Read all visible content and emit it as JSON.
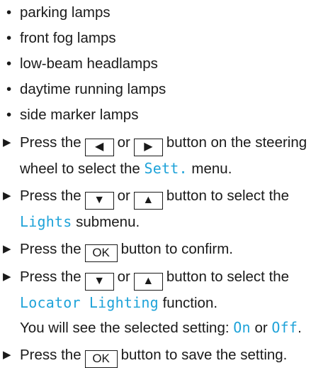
{
  "bullets": [
    "parking lamps",
    "front fog lamps",
    "low-beam headlamps",
    "daytime running lamps",
    "side marker lamps"
  ],
  "bullet_glyph": "•",
  "step_glyph": "▶",
  "keys": {
    "left": "◀",
    "right": "▶",
    "down": "▼",
    "up": "▲",
    "ok": "OK"
  },
  "steps": {
    "s1": {
      "t1": "Press the",
      "t2": "or",
      "t3": "button on the steering wheel to select the",
      "menu": "Sett.",
      "t4": "menu."
    },
    "s2": {
      "t1": "Press the",
      "t2": "or",
      "t3": "button to select the",
      "submenu": "Lights",
      "t4": "submenu."
    },
    "s3": {
      "t1": "Press the",
      "t2": "button to confirm."
    },
    "s4": {
      "t1": "Press the",
      "t2": "or",
      "t3": "button to select the",
      "function": "Locator Lighting",
      "t4": "function.",
      "t5": "You will see the selected setting:",
      "opt_on": "On",
      "t6": "or",
      "opt_off": "Off",
      "t7": "."
    },
    "s5": {
      "t1": "Press the",
      "t2": "button to save the setting."
    }
  },
  "colors": {
    "accent": "#1fa3d9",
    "text": "#1a1a1a"
  }
}
